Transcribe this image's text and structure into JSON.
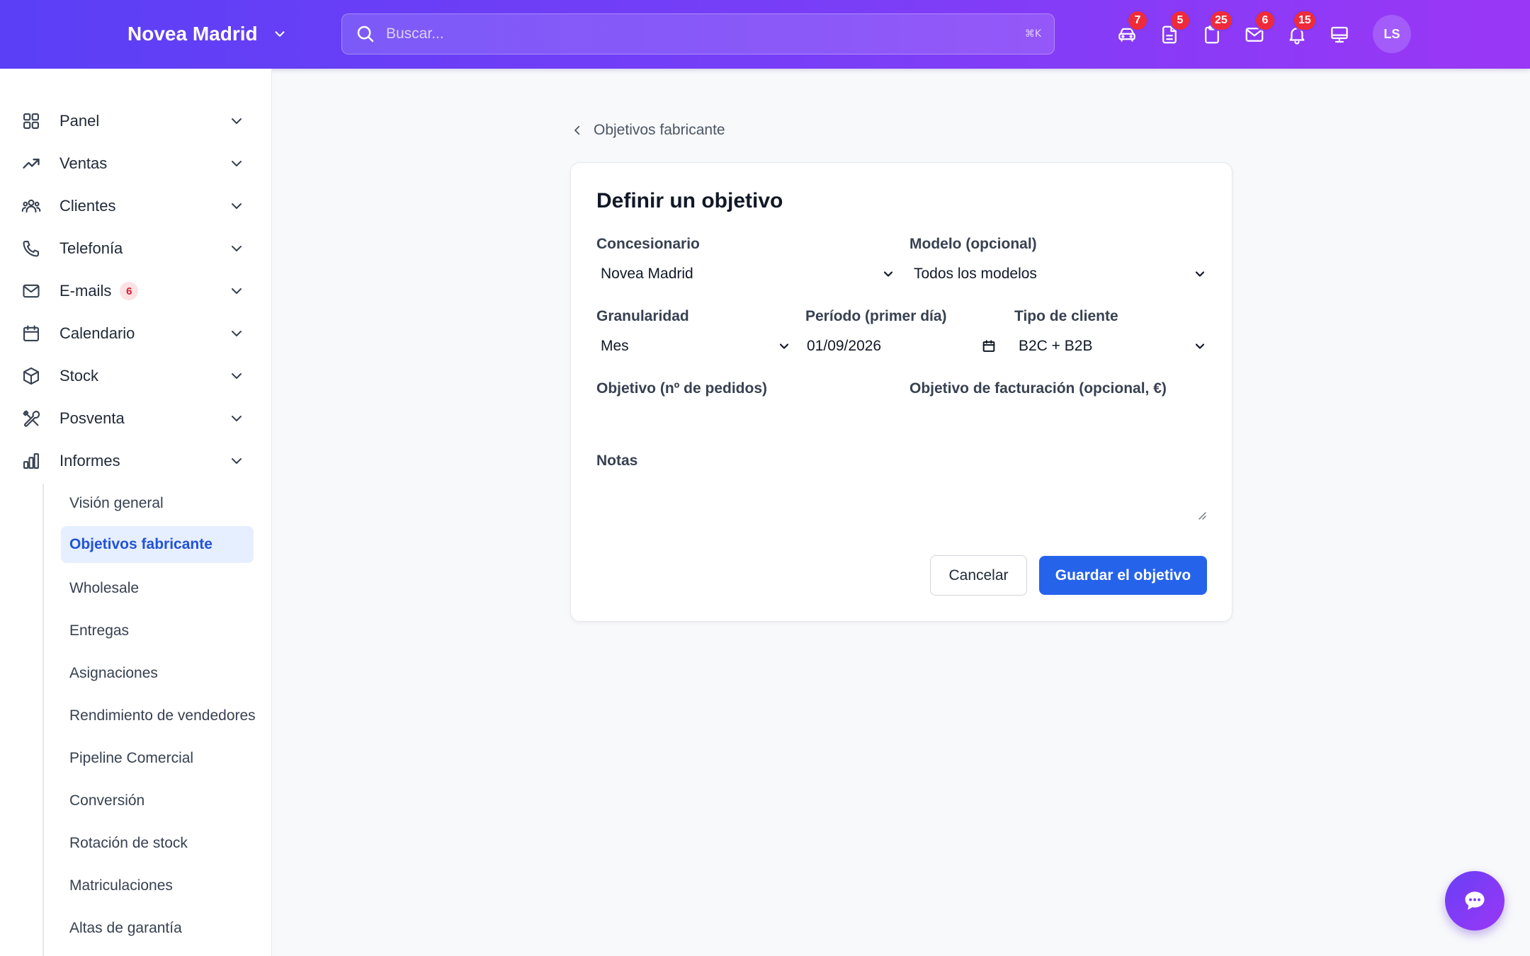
{
  "header": {
    "dealer_name": "Novea Madrid",
    "search_placeholder": "Buscar...",
    "search_shortcut": "⌘K",
    "icons": [
      {
        "name": "car-icon",
        "badge": "7"
      },
      {
        "name": "document-icon",
        "badge": "5"
      },
      {
        "name": "clipboard-icon",
        "badge": "25"
      },
      {
        "name": "mail-icon",
        "badge": "6"
      },
      {
        "name": "bell-icon",
        "badge": "15"
      },
      {
        "name": "monitor-icon",
        "badge": ""
      }
    ],
    "avatar_initials": "LS"
  },
  "sidebar": {
    "items": [
      {
        "label": "Panel",
        "icon": "grid-icon"
      },
      {
        "label": "Ventas",
        "icon": "trend-up-icon"
      },
      {
        "label": "Clientes",
        "icon": "users-icon"
      },
      {
        "label": "Telefonía",
        "icon": "phone-icon"
      },
      {
        "label": "E-mails",
        "icon": "mail-icon",
        "badge": "6"
      },
      {
        "label": "Calendario",
        "icon": "calendar-icon"
      },
      {
        "label": "Stock",
        "icon": "box-icon"
      },
      {
        "label": "Posventa",
        "icon": "tools-icon"
      },
      {
        "label": "Informes",
        "icon": "bar-chart-icon"
      }
    ],
    "report_subitems": [
      "Visión general",
      "Objetivos fabricante",
      "Wholesale",
      "Entregas",
      "Asignaciones",
      "Rendimiento de vendedores",
      "Pipeline Comercial",
      "Conversión",
      "Rotación de stock",
      "Matriculaciones",
      "Altas de garantía"
    ],
    "active_subitem": "Objetivos fabricante"
  },
  "main": {
    "back_label": "Objetivos fabricante",
    "card": {
      "title": "Definir un objetivo",
      "dealer_label": "Concesionario",
      "dealer_value": "Novea Madrid",
      "model_label": "Modelo (opcional)",
      "model_value": "Todos los modelos",
      "granularity_label": "Granularidad",
      "granularity_value": "Mes",
      "period_label": "Período (primer día)",
      "period_value": "01/09/2026",
      "customer_type_label": "Tipo de cliente",
      "customer_type_value": "B2C + B2B",
      "orders_target_label": "Objetivo (nº de pedidos)",
      "orders_target_value": "",
      "revenue_target_label": "Objetivo de facturación (opcional, €)",
      "revenue_target_value": "",
      "notes_label": "Notas",
      "notes_value": "",
      "cancel_label": "Cancelar",
      "save_label": "Guardar el objetivo"
    }
  },
  "colors": {
    "header_gradient_start": "#5a3ff6",
    "header_gradient_end": "#9a37f6",
    "badge_red": "#ef2b3a",
    "primary_blue": "#2563eb",
    "active_nav_bg": "#e5efff"
  }
}
